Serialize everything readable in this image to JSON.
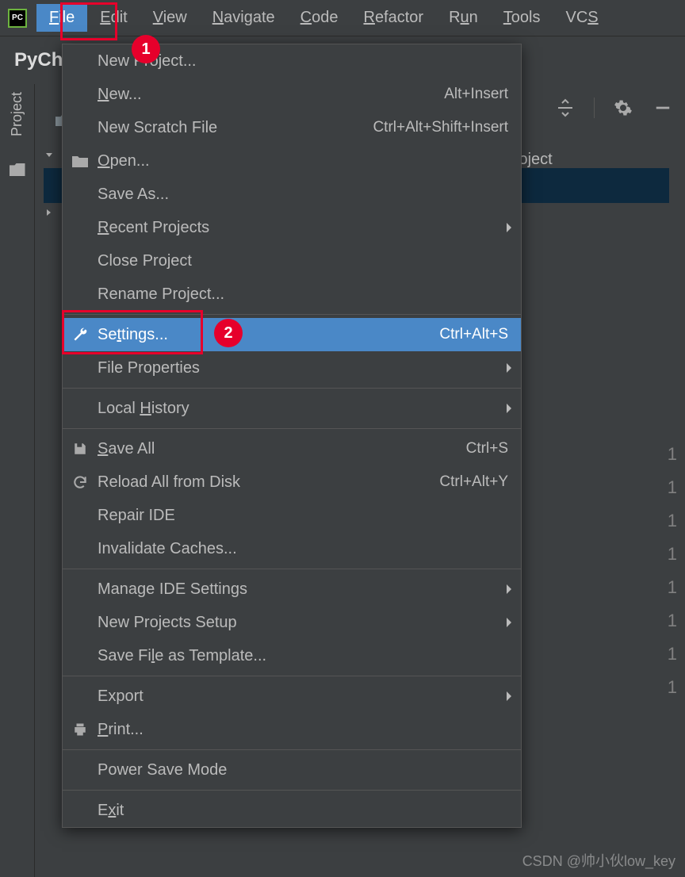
{
  "app": {
    "icon_label": "PC",
    "title_fragment": "PyCh"
  },
  "menubar": {
    "items": [
      {
        "label": "File",
        "mn": "F",
        "active": true
      },
      {
        "label": "Edit",
        "mn": "E"
      },
      {
        "label": "View",
        "mn": "V"
      },
      {
        "label": "Navigate",
        "mn": "N"
      },
      {
        "label": "Code",
        "mn": "C"
      },
      {
        "label": "Refactor",
        "mn": "R"
      },
      {
        "label": "Run",
        "mn": "u"
      },
      {
        "label": "Tools",
        "mn": "T"
      },
      {
        "label": "VCS",
        "mn": "S"
      }
    ]
  },
  "toolwindow": {
    "project_label": "Project"
  },
  "background": {
    "breadcrumb_tail": "armProject"
  },
  "gutter_numbers": [
    "1",
    "1",
    "1",
    "1",
    "1",
    "1",
    "1",
    "1"
  ],
  "dropdown": {
    "groups": [
      [
        {
          "label": "New Project...",
          "icon": ""
        },
        {
          "label": "New...",
          "mn": "N",
          "shortcut": "Alt+Insert",
          "icon": ""
        },
        {
          "label": "New Scratch File",
          "shortcut": "Ctrl+Alt+Shift+Insert",
          "icon": ""
        },
        {
          "label": "Open...",
          "mn": "O",
          "icon": "folder"
        },
        {
          "label": "Save As...",
          "icon": ""
        },
        {
          "label": "Recent Projects",
          "mn": "R",
          "submenu": true,
          "icon": ""
        },
        {
          "label": "Close Project",
          "icon": ""
        },
        {
          "label": "Rename Project...",
          "icon": ""
        }
      ],
      [
        {
          "label": "Settings...",
          "mn": "t",
          "shortcut": "Ctrl+Alt+S",
          "icon": "wrench",
          "hover": true
        },
        {
          "label": "File Properties",
          "submenu": true,
          "icon": ""
        }
      ],
      [
        {
          "label": "Local History",
          "mn": "H",
          "submenu": true,
          "icon": ""
        }
      ],
      [
        {
          "label": "Save All",
          "mn": "S",
          "shortcut": "Ctrl+S",
          "icon": "save"
        },
        {
          "label": "Reload All from Disk",
          "shortcut": "Ctrl+Alt+Y",
          "icon": "reload"
        },
        {
          "label": "Repair IDE",
          "icon": ""
        },
        {
          "label": "Invalidate Caches...",
          "icon": ""
        }
      ],
      [
        {
          "label": "Manage IDE Settings",
          "submenu": true,
          "icon": ""
        },
        {
          "label": "New Projects Setup",
          "submenu": true,
          "icon": ""
        },
        {
          "label": "Save File as Template...",
          "mn": "l",
          "icon": ""
        }
      ],
      [
        {
          "label": "Export",
          "submenu": true,
          "icon": ""
        },
        {
          "label": "Print...",
          "mn": "P",
          "icon": "print"
        }
      ],
      [
        {
          "label": "Power Save Mode",
          "icon": ""
        }
      ],
      [
        {
          "label": "Exit",
          "mn": "x",
          "icon": ""
        }
      ]
    ]
  },
  "annotations": {
    "n1": "1",
    "n2": "2"
  },
  "watermark": "CSDN @帅小伙low_key"
}
